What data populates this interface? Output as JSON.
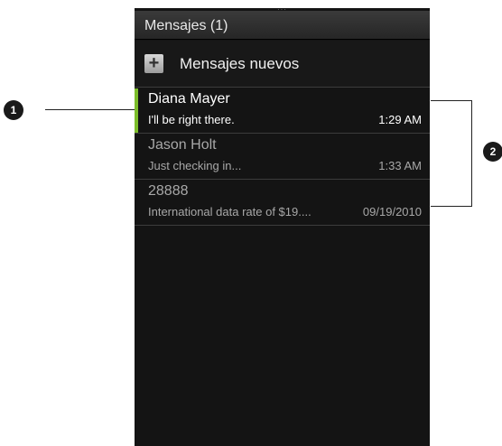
{
  "header": {
    "title": "Mensajes (1)"
  },
  "new_message": {
    "icon": "plus-icon",
    "label": "Mensajes nuevos"
  },
  "messages": [
    {
      "sender": "Diana Mayer",
      "preview": "I'll be right there.",
      "time": "1:29 AM",
      "unread": true
    },
    {
      "sender": "Jason Holt",
      "preview": "Just checking in...",
      "time": "1:33 AM",
      "unread": false
    },
    {
      "sender": "28888",
      "preview": "International data rate of $19....",
      "time": "09/19/2010",
      "unread": false
    }
  ],
  "callouts": [
    {
      "label": "1"
    },
    {
      "label": "2"
    }
  ],
  "colors": {
    "screen_bg": "#141414",
    "unread_accent": "#7bbd2a",
    "divider": "#3c3c3c"
  }
}
